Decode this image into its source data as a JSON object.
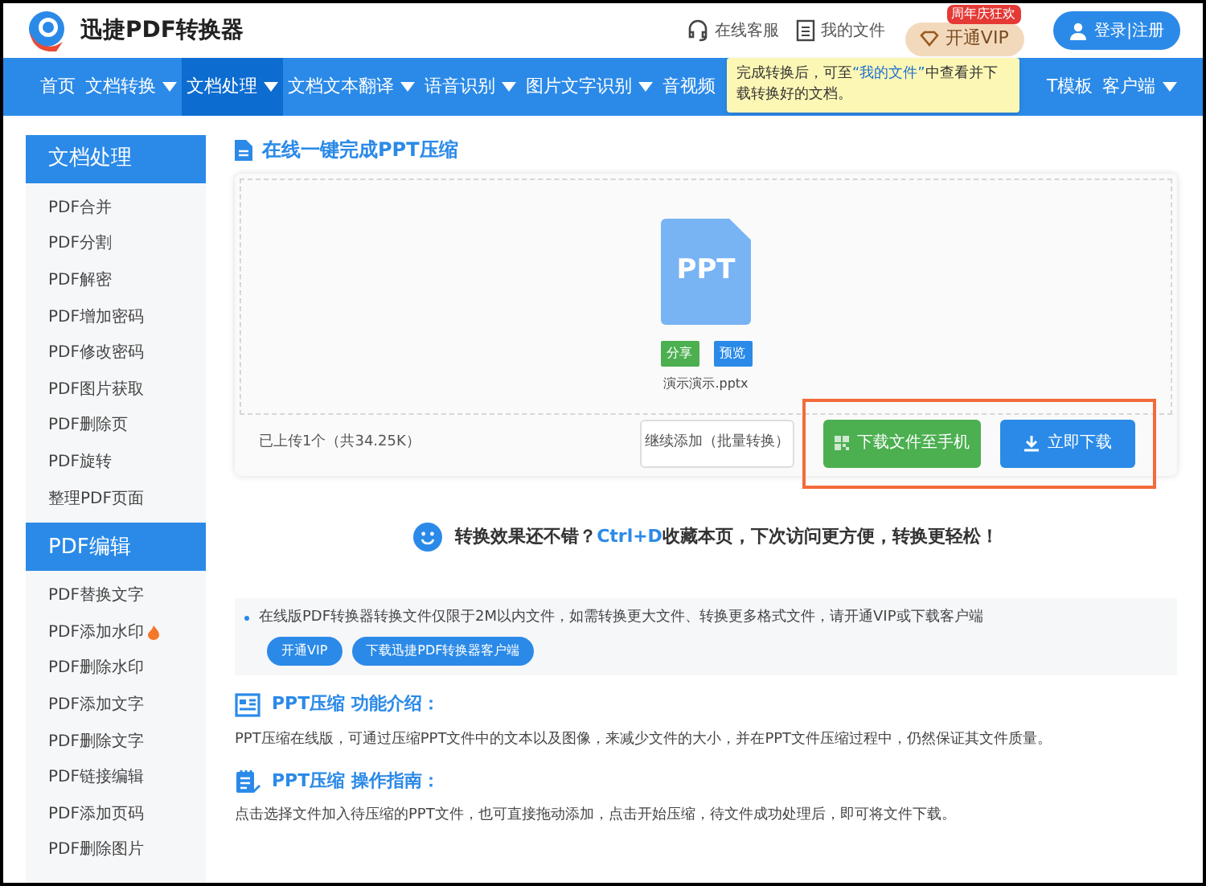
{
  "header": {
    "logo_text": "迅捷PDF转换器",
    "links": [
      {
        "kind": "headset",
        "label": "在线客服"
      },
      {
        "kind": "file",
        "label": "我的文件"
      }
    ],
    "vip_button": "开通VIP",
    "vip_badge": "周年庆狂欢",
    "login_button": "登录|注册"
  },
  "nav": [
    {
      "label": "首页",
      "dropdown": false,
      "selected": false
    },
    {
      "label": "文档转换",
      "dropdown": true,
      "selected": false
    },
    {
      "label": "文档处理",
      "dropdown": true,
      "selected": true
    },
    {
      "label": "文档文本翻译",
      "dropdown": true,
      "selected": false
    },
    {
      "label": "语音识别",
      "dropdown": true,
      "selected": false
    },
    {
      "label": "图片文字识别",
      "dropdown": true,
      "selected": false
    },
    {
      "label": "音视频",
      "dropdown": false,
      "selected": false
    },
    {
      "label": "T模板",
      "dropdown": false,
      "selected": false
    },
    {
      "label": "客户端",
      "dropdown": true,
      "selected": false
    }
  ],
  "tooltip": {
    "before": "完成转换后，可至",
    "link": "“我的文件”",
    "after": "中查看并下载转换好的文档。"
  },
  "sidebar": [
    {
      "title": "文档处理",
      "items": [
        {
          "label": "PDF合并",
          "hot": false
        },
        {
          "label": "PDF分割",
          "hot": false
        },
        {
          "label": "PDF解密",
          "hot": false
        },
        {
          "label": "PDF增加密码",
          "hot": false
        },
        {
          "label": "PDF修改密码",
          "hot": false
        },
        {
          "label": "PDF图片获取",
          "hot": false
        },
        {
          "label": "PDF删除页",
          "hot": false
        },
        {
          "label": "PDF旋转",
          "hot": false
        },
        {
          "label": "整理PDF页面",
          "hot": false
        }
      ]
    },
    {
      "title": "PDF编辑",
      "items": [
        {
          "label": "PDF替换文字",
          "hot": false
        },
        {
          "label": "PDF添加水印",
          "hot": true
        },
        {
          "label": "PDF删除水印",
          "hot": false
        },
        {
          "label": "PDF添加文字",
          "hot": false
        },
        {
          "label": "PDF删除文字",
          "hot": false
        },
        {
          "label": "PDF链接编辑",
          "hot": false
        },
        {
          "label": "PDF添加页码",
          "hot": false
        },
        {
          "label": "PDF删除图片",
          "hot": false
        }
      ]
    }
  ],
  "tool": {
    "title": "在线一键完成PPT压缩",
    "file": {
      "type_label": "PPT",
      "share": "分享",
      "preview": "预览",
      "name": "演示演示.pptx"
    },
    "upload_count": "已上传1个（共34.25K）",
    "add_more": "继续添加（批量转换）",
    "download_phone": "下载文件至手机",
    "download_now": "立即下载"
  },
  "bookmark": {
    "before": "转换效果还不错？",
    "shortcut": "Ctrl+D",
    "after": "收藏本页，下次访问更方便，转换更轻松！"
  },
  "notice": {
    "text": "在线版PDF转换器转换文件仅限于2M以内文件，如需转换更大文件、转换更多格式文件，请开通VIP或下载客户端",
    "buttons": [
      "开通VIP",
      "下载迅捷PDF转换器客户端"
    ]
  },
  "sections": [
    {
      "kind": "intro",
      "title": "PPT压缩 功能介绍：",
      "text": "PPT压缩在线版，可通过压缩PPT文件中的文本以及图像，来减少文件的大小，并在PPT文件压缩过程中，仍然保证其文件质量。"
    },
    {
      "kind": "guide",
      "title": "PPT压缩 操作指南：",
      "text": "点击选择文件加入待压缩的PPT文件，也可直接拖动添加，点击开始压缩，待文件成功处理后，即可将文件下载。"
    }
  ]
}
